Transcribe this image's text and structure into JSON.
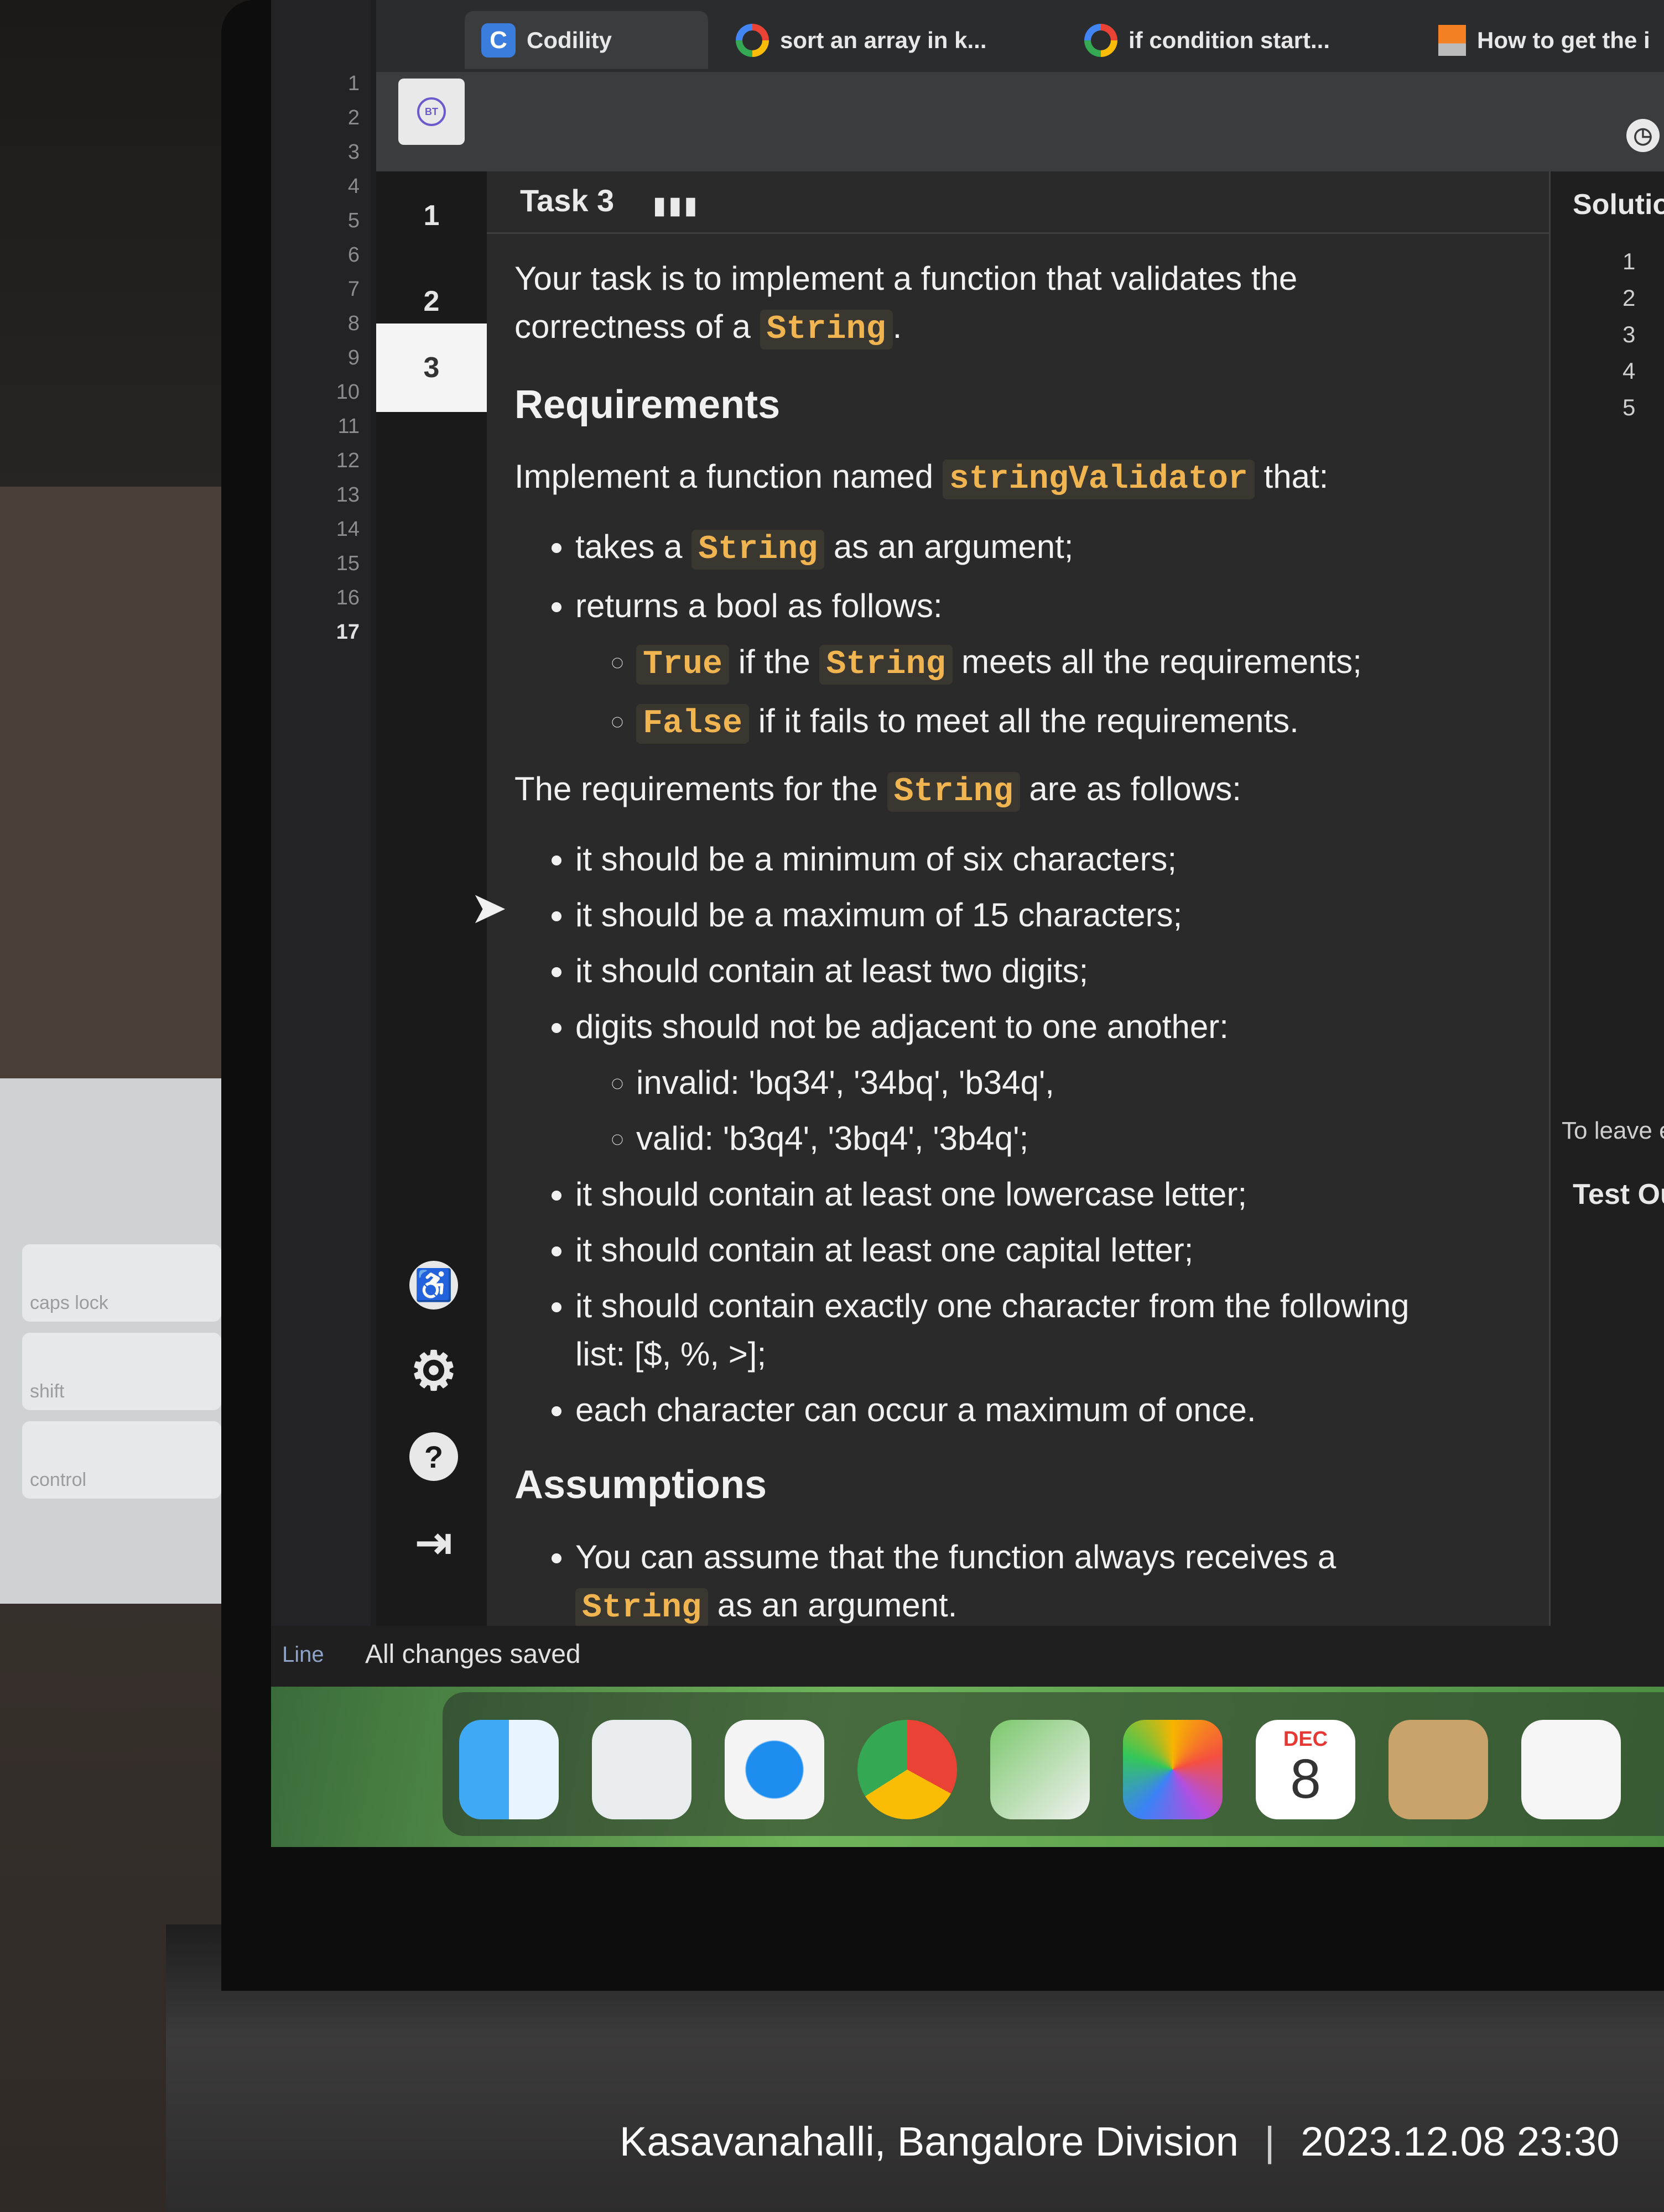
{
  "editor": {
    "line_numbers": [
      "1",
      "2",
      "3",
      "4",
      "5",
      "6",
      "7",
      "8",
      "9",
      "10",
      "11",
      "12",
      "13",
      "14",
      "15",
      "16",
      "17"
    ],
    "status_left": "Line"
  },
  "browser": {
    "tabs": [
      {
        "label": "Codility",
        "icon": "codility-icon"
      },
      {
        "label": "sort an array in k...",
        "icon": "google-icon"
      },
      {
        "label": "if condition start...",
        "icon": "google-icon"
      },
      {
        "label": "How to get the i",
        "icon": "stackoverflow-icon"
      }
    ]
  },
  "codility": {
    "avatar_initials": "BT",
    "task_numbers": [
      "1",
      "2",
      "3"
    ],
    "active_task": "3",
    "task_title": "Task 3",
    "intro_pre": "Your task is to implement a function that validates the correctness of a",
    "intro_code": "String",
    "intro_post": ".",
    "h_requirements": "Requirements",
    "impl_pre": "Implement a function named",
    "impl_code": "stringValidator",
    "impl_post": "that:",
    "takes_pre": "takes a",
    "takes_code": "String",
    "takes_post": "as an argument;",
    "returns": "returns a bool as follows:",
    "true_code": "True",
    "true_mid": "if the",
    "true_code2": "String",
    "true_post": "meets all the requirements;",
    "false_code": "False",
    "false_post": "if it fails to meet all the requirements.",
    "reqs_pre": "The requirements for the",
    "reqs_code": "String",
    "reqs_post": "are as follows:",
    "req1": "it should be a minimum of six characters;",
    "req2": "it should be a maximum of 15 characters;",
    "req3": "it should contain at least two digits;",
    "req4": "digits should not be adjacent to one another:",
    "req4a": "invalid: 'bq34', '34bq', 'b34q',",
    "req4b": "valid: 'b3q4', '3bq4', '3b4q';",
    "req5": "it should contain at least one lowercase letter;",
    "req6": "it should contain at least one capital letter;",
    "req7": "it should contain exactly one character from the following list: [$, %, >];",
    "req8": "each character can occur a maximum of once.",
    "h_assumptions": "Assumptions",
    "assume_pre": "You can assume that the function always receives a",
    "assume_code": "String",
    "assume_post": "as an argument.",
    "status": "All changes saved",
    "solution_title": "Solution",
    "solution_lines": [
      "1",
      "2",
      "3",
      "4",
      "5"
    ],
    "leave_edit": "To leave edit",
    "test_output": "Test Outp"
  },
  "dock": {
    "calendar_month": "DEC",
    "calendar_day": "8",
    "apps": [
      "finder-icon",
      "launchpad-icon",
      "safari-icon",
      "chrome-icon",
      "maps-icon",
      "photos-icon",
      "calendar-icon",
      "contacts-icon",
      "reminders-icon"
    ]
  },
  "keyboard": {
    "keys": [
      "control",
      "shift",
      "caps lock"
    ]
  },
  "photo_caption": {
    "location": "Kasavanahalli, Bangalore Division",
    "datetime": "2023.12.08 23:30"
  }
}
